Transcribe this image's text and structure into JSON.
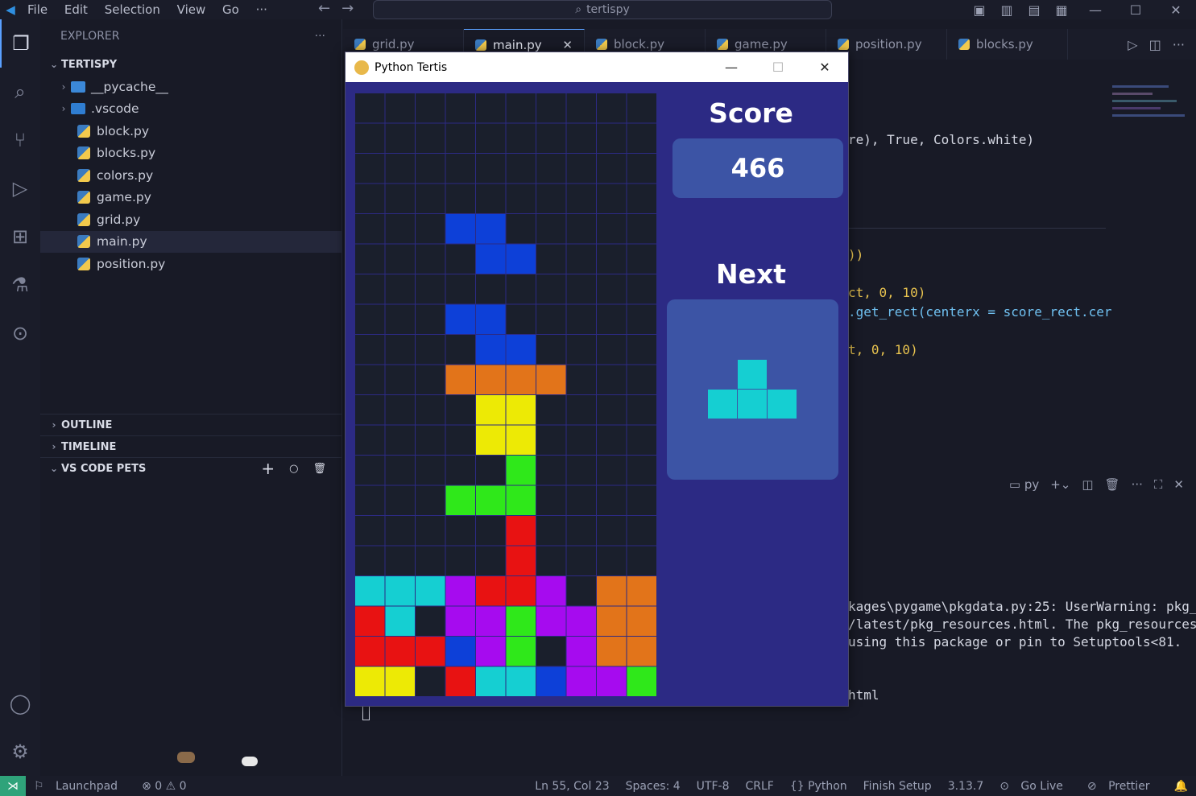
{
  "menu": {
    "items": [
      "File",
      "Edit",
      "Selection",
      "View",
      "Go",
      "···"
    ]
  },
  "search": {
    "text": "tertispy"
  },
  "explorer": {
    "title": "EXPLORER",
    "root": "TERTISPY",
    "folders": [
      "__pycache__",
      ".vscode"
    ],
    "files": [
      "block.py",
      "blocks.py",
      "colors.py",
      "game.py",
      "grid.py",
      "main.py",
      "position.py"
    ],
    "selected": "main.py",
    "sections": [
      "OUTLINE",
      "TIMELINE",
      "VS CODE PETS"
    ]
  },
  "tabs": [
    {
      "label": "grid.py"
    },
    {
      "label": "main.py",
      "active": true
    },
    {
      "label": "block.py"
    },
    {
      "label": "game.py"
    },
    {
      "label": "position.py"
    },
    {
      "label": "blocks.py"
    }
  ],
  "editor": {
    "line1": "re), True, Colors.white)",
    "line2": "))",
    "line3": "ct, 0, 10)",
    "line4": ".get_rect(centerx = score_rect.cer",
    "line5": "t, 0, 10)"
  },
  "terminal": {
    "shell_label": "py",
    "line1": "kages\\pygame\\pkgdata.py:25: UserWarning: pkg_r",
    "line2": "/latest/pkg_resources.html. The pkg_resources",
    "line3": "using this package or pin to Setuptools<81.",
    "line4": "html"
  },
  "statusbar": {
    "launchpad": "Launchpad",
    "problems": "⊗ 0 ⚠ 0",
    "position": "Ln 55, Col 23",
    "spaces": "Spaces: 4",
    "encoding": "UTF-8",
    "eol": "CRLF",
    "language": "{} Python",
    "finish": "Finish Setup",
    "version": "3.13.7",
    "golive": "Go Live",
    "prettier": "Prettier"
  },
  "game": {
    "window_title": "Python Tertis",
    "score_label": "Score",
    "score": "466",
    "next_label": "Next",
    "colors": {
      "background": "#2c2a84",
      "empty": "#1a1f2c",
      "gridline": "#2c2a84",
      "green": "#2fe81a",
      "red": "#e81212",
      "orange": "#e2741a",
      "yellow": "#edea05",
      "purple": "#a60bef",
      "cyan": "#15cfd2",
      "blue": "#0d40d8"
    },
    "grid_rows": [
      "..........",
      "..........",
      "..........",
      "..........",
      "...BB.....",
      "....BB....",
      "..........",
      "...BB.....",
      "....BB....",
      "...OOOO...",
      "....YY....",
      "....YY....",
      ".....G....",
      "...GGG....",
      ".....R....",
      ".....R....",
      "CCCPRRP.OO",
      "RC.PPGPPOO",
      "RRRBPG.POO",
      "YY.RCCBPPG"
    ],
    "next_piece": [
      ".C.",
      "CCC"
    ]
  }
}
